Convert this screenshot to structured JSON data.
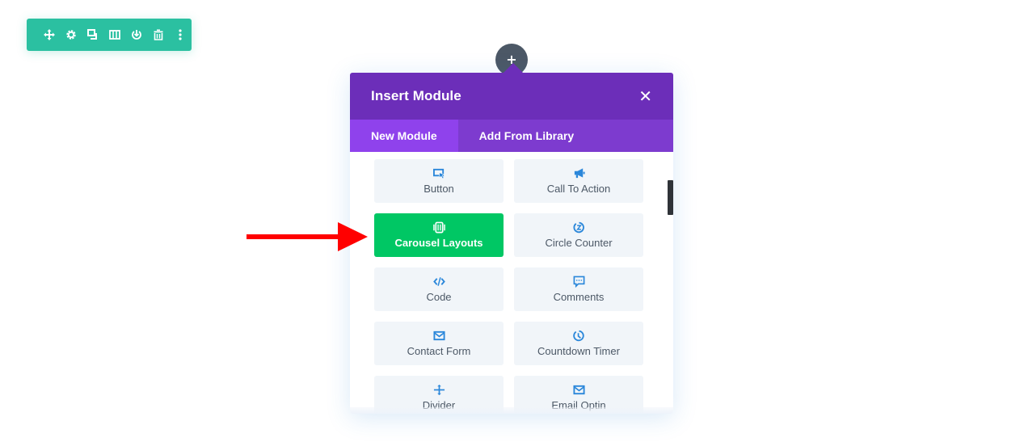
{
  "row_toolbar": {
    "color": "#2bc0a1",
    "buttons": [
      {
        "name": "move",
        "icon": "move-icon"
      },
      {
        "name": "settings",
        "icon": "gear-icon"
      },
      {
        "name": "duplicate",
        "icon": "duplicate-icon"
      },
      {
        "name": "columns",
        "icon": "columns-icon"
      },
      {
        "name": "save-to-library",
        "icon": "save-icon"
      },
      {
        "name": "delete",
        "icon": "trash-icon"
      },
      {
        "name": "more",
        "icon": "more-vertical-icon"
      }
    ]
  },
  "add_button": {
    "label": "+",
    "icon": "plus-icon"
  },
  "modal": {
    "title": "Insert Module",
    "close_label": "✕",
    "header_color": "#6c2eb9",
    "tabs": [
      {
        "label": "New Module",
        "active": true
      },
      {
        "label": "Add From Library",
        "active": false
      }
    ],
    "modules": [
      {
        "label": "Button",
        "icon": "button-cursor-icon",
        "highlight": false
      },
      {
        "label": "Call To Action",
        "icon": "megaphone-icon",
        "highlight": false
      },
      {
        "label": "Carousel Layouts",
        "icon": "carousel-icon",
        "highlight": true
      },
      {
        "label": "Circle Counter",
        "icon": "circle-counter-icon",
        "highlight": false
      },
      {
        "label": "Code",
        "icon": "code-icon",
        "highlight": false
      },
      {
        "label": "Comments",
        "icon": "comments-icon",
        "highlight": false
      },
      {
        "label": "Contact Form",
        "icon": "envelope-icon",
        "highlight": false
      },
      {
        "label": "Countdown Timer",
        "icon": "timer-icon",
        "highlight": false
      },
      {
        "label": "Divider",
        "icon": "divider-icon",
        "highlight": false
      },
      {
        "label": "Email Optin",
        "icon": "envelope-icon",
        "highlight": false
      }
    ],
    "highlight_color": "#00c764",
    "icon_color": "#2b87da"
  },
  "annotation": {
    "type": "arrow",
    "color": "#ff0000",
    "points_to": "Carousel Layouts"
  }
}
